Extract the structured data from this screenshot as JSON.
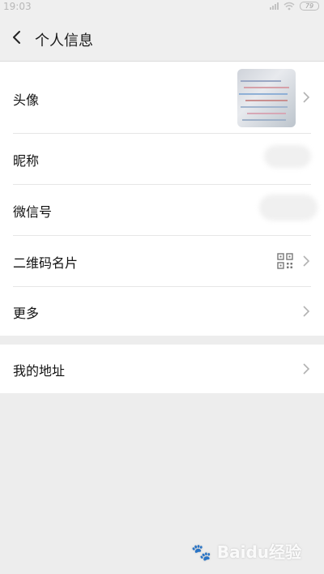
{
  "status_bar": {
    "time": "19:03",
    "battery": "79"
  },
  "nav": {
    "title": "个人信息"
  },
  "rows": {
    "avatar": {
      "label": "头像"
    },
    "nickname": {
      "label": "昵称"
    },
    "wechat_id": {
      "label": "微信号"
    },
    "qr_card": {
      "label": "二维码名片"
    },
    "more": {
      "label": "更多"
    },
    "address": {
      "label": "我的地址"
    }
  },
  "watermark": {
    "text": "Baidu经验"
  },
  "icons": [
    "back-arrow-icon",
    "chevron-right-icon",
    "qr-code-icon",
    "signal-icon",
    "wifi-icon",
    "battery-icon",
    "baidu-logo-icon"
  ],
  "colors": {
    "background": "#ededed",
    "card": "#ffffff",
    "divider": "#e6e6e6",
    "chevron": "#b2b2b2"
  }
}
